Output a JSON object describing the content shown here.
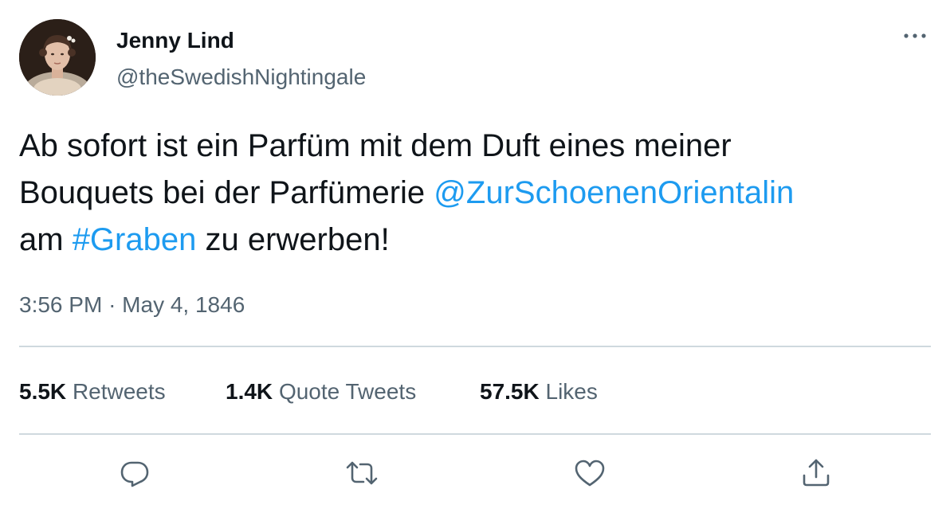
{
  "author": {
    "name": "Jenny Lind",
    "handle": "@theSwedishNightingale"
  },
  "tweet": {
    "text_parts": [
      "Ab sofort ist ein Parfüm mit dem Duft eines meiner",
      "Bouquets bei der Parfümerie ",
      "@ZurSchoenenOrientalin",
      "am ",
      "#Graben",
      " zu erwerben!"
    ],
    "time": "3:56 PM",
    "separator": "·",
    "date": "May 4, 1846"
  },
  "stats": {
    "retweets_count": "5.5K",
    "retweets_label": "Retweets",
    "quotes_count": "1.4K",
    "quotes_label": "Quote Tweets",
    "likes_count": "57.5K",
    "likes_label": "Likes"
  },
  "icons": {
    "more": "more-horizontal-icon",
    "reply": "reply-bubble-icon",
    "retweet": "retweet-arrows-icon",
    "like": "heart-icon",
    "share": "share-upload-icon"
  },
  "colors": {
    "link": "#1d9bf0",
    "secondary_text": "#536471",
    "divider": "#cfd9de",
    "primary_text": "#0f1419"
  }
}
